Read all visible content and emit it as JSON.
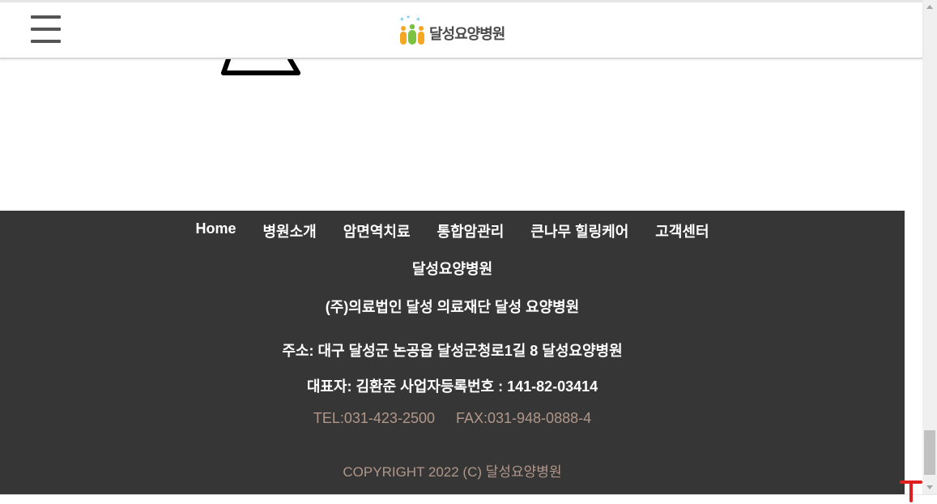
{
  "header": {
    "logo_text": "달성요양병원",
    "menu_icon": "hamburger-menu-icon"
  },
  "footer": {
    "nav": [
      {
        "label": "Home"
      },
      {
        "label": "병원소개"
      },
      {
        "label": "암면역치료"
      },
      {
        "label": "통합암관리"
      },
      {
        "label": "큰나무 힐링케어"
      },
      {
        "label": "고객센터"
      }
    ],
    "hospital_name": "달성요양병원",
    "corporation": "(주)의료법인 달성 의료재단 달성 요양병원",
    "address": "주소: 대구 달성군 논공읍 달성군청로1길 8 달성요양병원",
    "representative": "대표자: 김환준 사업자등록번호 : 141-82-03414",
    "tel": "TEL:031-423-2500",
    "fax": "FAX:031-948-0888-4",
    "copyright": "COPYRIGHT 2022 (C) 달성요양병원"
  },
  "colors": {
    "footer_bg": "#363636",
    "footer_muted_text": "#b0978a",
    "top_button": "#e02020"
  }
}
